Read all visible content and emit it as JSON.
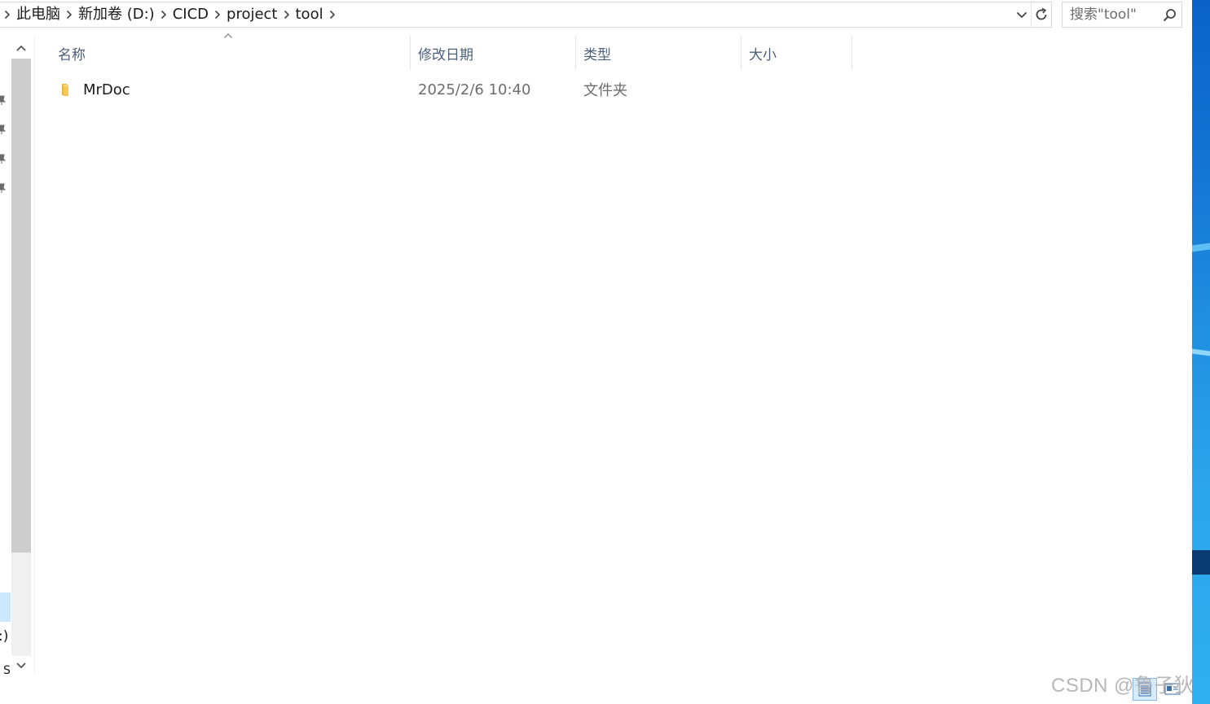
{
  "address_bar": {
    "crumbs": [
      "此电脑",
      "新加卷 (D:)",
      "CICD",
      "project",
      "tool"
    ]
  },
  "search": {
    "placeholder": "搜索\"tool\""
  },
  "columns": {
    "name": "名称",
    "modified": "修改日期",
    "type": "类型",
    "size": "大小"
  },
  "files": [
    {
      "name": "MrDoc",
      "modified": "2025/2/6 10:40",
      "type": "文件夹",
      "size": ""
    }
  ],
  "nav_pane": {
    "drive_fragment": ":)",
    "bottom_fragment": "S"
  },
  "watermark": "CSDN @鲁子狄",
  "colors": {
    "header_text": "#4c607a",
    "folder_yellow": "#f5c858",
    "selection": "#cce8ff"
  }
}
